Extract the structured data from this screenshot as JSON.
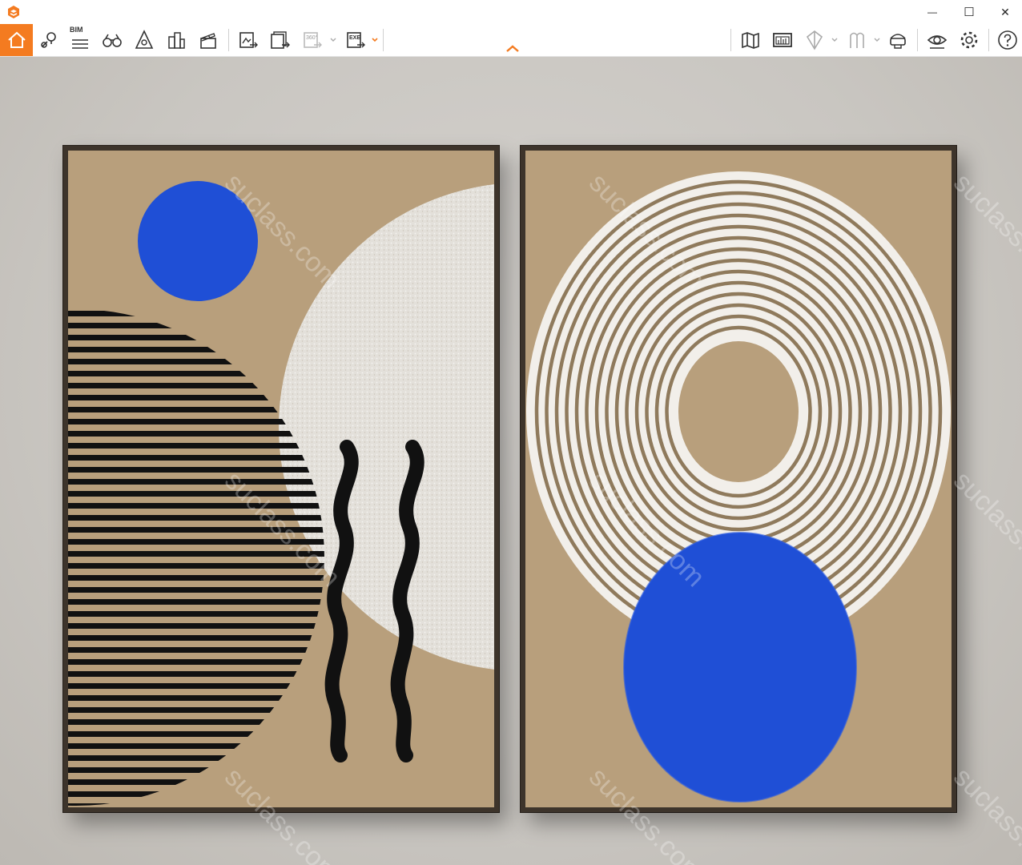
{
  "window": {
    "minimize_glyph": "—",
    "maximize_glyph": "☐",
    "close_glyph": "✕"
  },
  "toolbar": {
    "bim_label": "BIM",
    "badge_360": "360°",
    "badge_exe": "EXE",
    "accent_color": "#f47b20",
    "icons": [
      "home-icon",
      "location-pin-icon",
      "bim-menu-icon",
      "binoculars-icon",
      "perspective-icon",
      "buildings-icon",
      "clapperboard-icon",
      "export-image-icon",
      "export-multi-image-icon",
      "export-360-icon",
      "export-exe-icon",
      "map-icon",
      "panel-icon",
      "section-icon",
      "compare-icon",
      "vr-icon",
      "view-icon",
      "settings-icon",
      "help-icon"
    ]
  },
  "viewport": {
    "watermark": "suclass.com",
    "artwork": {
      "blue": "#1f4fd6",
      "tan": "#b89f7c",
      "black": "#111111",
      "white": "#f2efea"
    }
  }
}
